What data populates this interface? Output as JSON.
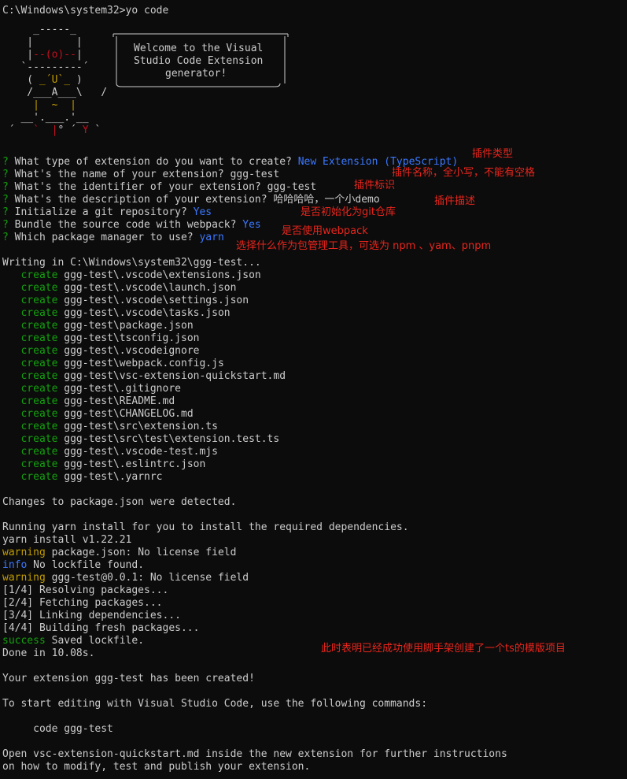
{
  "prompt": "C:\\Windows\\system32>yo code",
  "banner": {
    "welcome_line1": "Welcome to the Visual",
    "welcome_line2": "Studio Code Extension",
    "welcome_line3": "generator!"
  },
  "questions": [
    {
      "q": "What type of extension do you want to create?",
      "a": "New Extension (TypeScript)",
      "note": "插件类型"
    },
    {
      "q": "What's the name of your extension?",
      "a": "ggg-test",
      "note": "插件名称，全小写，不能有空格"
    },
    {
      "q": "What's the identifier of your extension?",
      "a": "ggg-test",
      "note": "插件标识"
    },
    {
      "q": "What's the description of your extension?",
      "a": "哈哈哈哈，一个小demo",
      "note": "插件描述"
    },
    {
      "q": "Initialize a git repository?",
      "a": "Yes",
      "note": "是否初始化为git仓库"
    },
    {
      "q": "Bundle the source code with webpack?",
      "a": "Yes",
      "note": "是否使用webpack"
    },
    {
      "q": "Which package manager to use?",
      "a": "yarn",
      "note": "选择什么作为包管理工具，可选为 npm 、yam、pnpm"
    }
  ],
  "question_mark": "?",
  "writing": "Writing in C:\\Windows\\system32\\ggg-test...",
  "create_word": "create",
  "created_files": [
    "ggg-test\\.vscode\\extensions.json",
    "ggg-test\\.vscode\\launch.json",
    "ggg-test\\.vscode\\settings.json",
    "ggg-test\\.vscode\\tasks.json",
    "ggg-test\\package.json",
    "ggg-test\\tsconfig.json",
    "ggg-test\\.vscodeignore",
    "ggg-test\\webpack.config.js",
    "ggg-test\\vsc-extension-quickstart.md",
    "ggg-test\\.gitignore",
    "ggg-test\\README.md",
    "ggg-test\\CHANGELOG.md",
    "ggg-test\\src\\extension.ts",
    "ggg-test\\src\\test\\extension.test.ts",
    "ggg-test\\.vscode-test.mjs",
    "ggg-test\\.eslintrc.json",
    "ggg-test\\.yarnrc"
  ],
  "changes": "Changes to package.json were detected.",
  "running": "Running yarn install for you to install the required dependencies.",
  "yarn_version": "yarn install v1.22.21",
  "warn1_tag": "warning",
  "warn1_text": " package.json: No license field",
  "info_tag": "info",
  "info_text": " No lockfile found.",
  "warn2_tag": "warning",
  "warn2_text": " ggg-test@0.0.1: No license field",
  "steps": [
    "[1/4] Resolving packages...",
    "[2/4] Fetching packages...",
    "[3/4] Linking dependencies...",
    "[4/4] Building fresh packages..."
  ],
  "success_tag": "success",
  "success_text": " Saved lockfile.",
  "done": "Done in 10.08s.",
  "done_note": "此时表明已经成功使用脚手架创建了一个ts的模版项目",
  "created_msg": "Your extension ggg-test has been created!",
  "start_editing": "To start editing with Visual Studio Code, use the following commands:",
  "code_cmd": "     code ggg-test",
  "open1": "Open vsc-extension-quickstart.md inside the new extension for further instructions",
  "open2": "on how to modify, test and publish your extension.",
  "colors": {
    "green": "#13a10e",
    "blue": "#3b78ff",
    "yellow": "#c19c00",
    "red_note": "#e8251c"
  }
}
